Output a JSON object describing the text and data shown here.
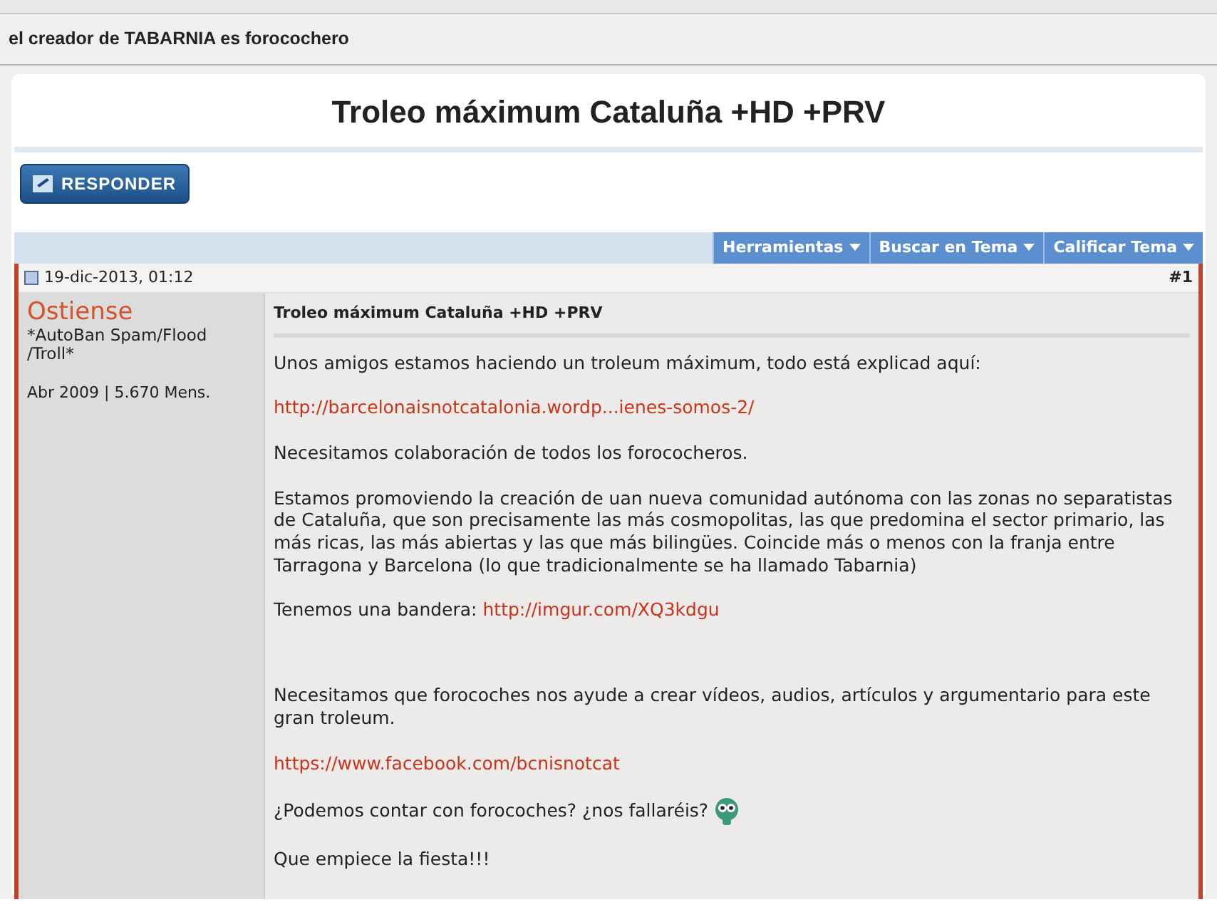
{
  "thread_bar": {
    "title": "el creador de TABARNIA es forocochero"
  },
  "thread_title": "Troleo máximum Cataluña +HD +PRV",
  "reply_button": {
    "label": "RESPONDER"
  },
  "tools": [
    {
      "label": "Herramientas"
    },
    {
      "label": "Buscar en Tema"
    },
    {
      "label": "Calificar Tema"
    }
  ],
  "post": {
    "date": "19-dic-2013, 01:12",
    "number": "#1",
    "author": {
      "name": "Ostiense",
      "title": "*AutoBan Spam/Flood /Troll*",
      "meta": "Abr 2009 | 5.670 Mens."
    },
    "subject": "Troleo máximum Cataluña +HD +PRV",
    "body": [
      {
        "kind": "text",
        "text": "Unos amigos estamos haciendo un troleum máximum, todo está explicad aquí:"
      },
      {
        "kind": "link",
        "text": "http://barcelonaisnotcatalonia.wordp...ienes-somos-2/"
      },
      {
        "kind": "text",
        "text": "Necesitamos colaboración de todos los forococheros."
      },
      {
        "kind": "text",
        "text": "Estamos promoviendo la creación de uan nueva comunidad autónoma con las zonas no separatistas de Cataluña, que son precisamente las más cosmopolitas, las que predomina el sector primario, las más ricas, las más abiertas y las que más bilingües. Coincide más o menos con la franja entre Tarragona y Barcelona (lo que tradicionalmente se ha llamado Tabarnia)"
      },
      {
        "kind": "text-link",
        "text": "Tenemos una bandera:",
        "link": "http://imgur.com/XQ3kdgu"
      },
      {
        "kind": "blank"
      },
      {
        "kind": "text",
        "text": "Necesitamos que forocoches nos ayude a crear vídeos, audios, artículos y argumentario para este gran troleum."
      },
      {
        "kind": "link",
        "text": "https://www.facebook.com/bcnisnotcat"
      },
      {
        "kind": "text-smiley",
        "text": "¿Podemos contar con forocoches? ¿nos fallaréis?"
      },
      {
        "kind": "text",
        "text": "Que empiece la fiesta!!!"
      }
    ]
  }
}
